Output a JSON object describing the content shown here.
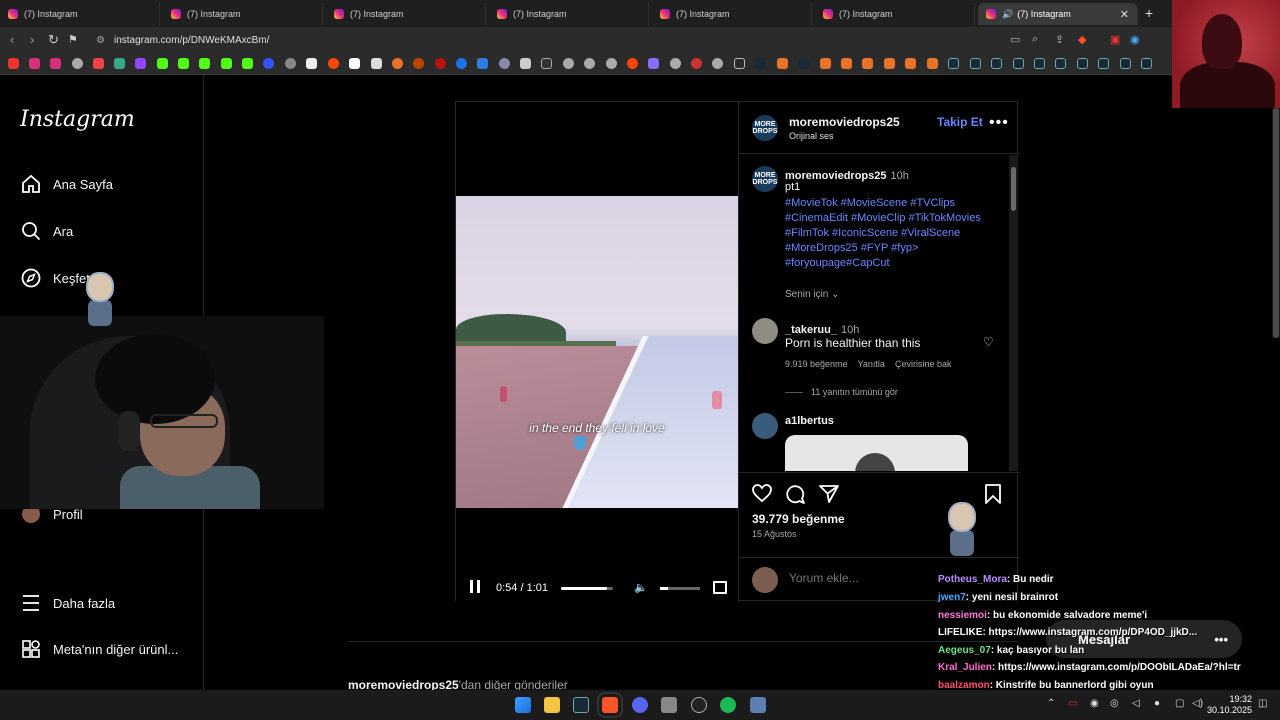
{
  "browser": {
    "tabs": [
      "(7) Instagram",
      "(7) Instagram",
      "(7) Instagram",
      "(7) Instagram",
      "(7) Instagram",
      "(7) Instagram",
      "(7) Instagram"
    ],
    "url": "instagram.com/p/DNWeKMAxcBm/"
  },
  "sidebar": {
    "logo": "Instagram",
    "items": {
      "home": "Ana Sayfa",
      "search": "Ara",
      "explore": "Keşfet",
      "profile": "Profil",
      "more": "Daha fazla",
      "meta": "Meta'nın diğer ürünl..."
    }
  },
  "post": {
    "author": "moremoviedrops25",
    "audio": "Orijinal ses",
    "follow": "Takip Et",
    "avatar_text": "MORE DROPS",
    "caption": {
      "time": "10h",
      "text": "pt1",
      "hashtags": [
        "#MovieTok #MovieScene #TVClips",
        "#CinemaEdit #MovieClip #TikTokMovies",
        "#FilmTok #IconicScene #ViralScene",
        "#MoreDrops25 #FYP #fyp>",
        "#foryoupage#CapCut"
      ]
    },
    "translation_toggle": "Senin için",
    "comments": [
      {
        "user": "_takeruu_",
        "time": "10h",
        "text": "Porn is healthier than this",
        "likes": "9.919 beğenme",
        "reply": "Yanıtla",
        "translate": "Çevirisine bak",
        "view_replies": "11 yanıtın tümünü gör"
      },
      {
        "user": "a1lbertus"
      }
    ],
    "likes": "39.779 beğenme",
    "date": "15 Ağustos",
    "comment_placeholder": "Yorum ekle...",
    "video": {
      "subtitle": "in the end they fell in love",
      "time": "0:54 / 1:01",
      "progress": 0.885,
      "volume": 0.2
    },
    "more_from": "moremoviedrops25",
    "more_from_suffix": "'dan diğer gönderiler"
  },
  "chat": [
    {
      "user": "Potheus_Mora",
      "msg": ": Bu nedir",
      "color": "#b68cff"
    },
    {
      "user": "jwen7",
      "msg": ": yeni nesil brainrot",
      "color": "#4aa8ff"
    },
    {
      "user": "nessiemoi",
      "msg": ": bu ekonomide salvadore meme'i",
      "color": "#ff7ad9"
    },
    {
      "user": "LIFELIKE",
      "msg": ": https://www.instagram.com/p/DP4OD_jjkD...",
      "color": "#ffffff"
    },
    {
      "user": "Aegeus_07",
      "msg": ": kaç basıyor bu lan",
      "color": "#6be38a"
    },
    {
      "user": "Kral_Julien",
      "msg": ": https://www.instagram.com/p/DOObILADaEa/?hl=tr",
      "color": "#ff6ad5"
    },
    {
      "user": "baalzamon",
      "msg": ": Kinstrife bu bannerlord gibi oyun",
      "color": "#ff4f6b"
    }
  ],
  "messages_button": "Mesajlar",
  "taskbar": {
    "time": "19:32",
    "date": "30.10.2025"
  }
}
